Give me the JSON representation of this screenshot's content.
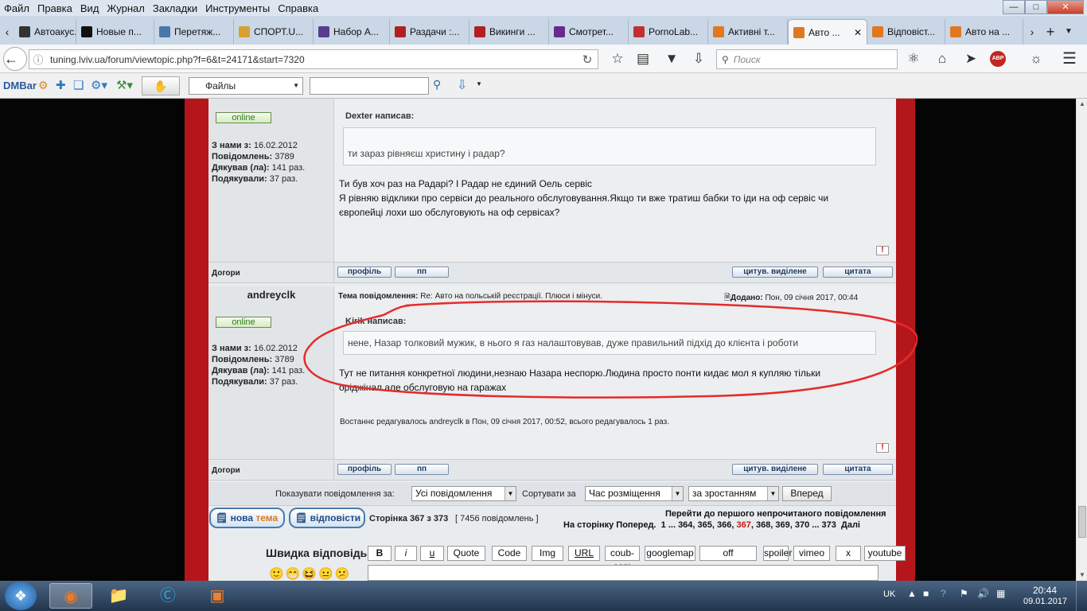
{
  "menu": [
    "Файл",
    "Правка",
    "Вид",
    "Журнал",
    "Закладки",
    "Инструменты",
    "Справка"
  ],
  "tabs": [
    {
      "label": "Автоакус...",
      "color": "#333"
    },
    {
      "label": "Новые п...",
      "color": "#111"
    },
    {
      "label": "Перетяж...",
      "color": "#4a76a8"
    },
    {
      "label": "СПОРТ.U...",
      "color": "#d8a030"
    },
    {
      "label": "Набор A...",
      "color": "#5a3c8c"
    },
    {
      "label": "Раздачи :...",
      "color": "#b02020"
    },
    {
      "label": "Викинги ...",
      "color": "#b02020"
    },
    {
      "label": "Смотрет...",
      "color": "#6a2a8a"
    },
    {
      "label": "PornoLab...",
      "color": "#c03030"
    },
    {
      "label": "Активні т...",
      "color": "#e07820"
    },
    {
      "label": "Авто ...",
      "color": "#e07820"
    },
    {
      "label": "Відповіст...",
      "color": "#e07820"
    },
    {
      "label": "Авто на ...",
      "color": "#e07820"
    }
  ],
  "url": "tuning.lviv.ua/forum/viewtopic.php?f=6&t=24171&start=7320",
  "search_placeholder": "Поиск",
  "dmbar": {
    "label": "DMBar",
    "files": "Файлы"
  },
  "post1": {
    "online": "online",
    "joined_label": "З нами з:",
    "joined": "16.02.2012",
    "posts_label": "Повідомлень:",
    "posts": "3789",
    "thanked_label": "Дякував (ла):",
    "thanked": "141 раз.",
    "thanks_label": "Подякували:",
    "thanks": "37 раз.",
    "quote_author": "Dexter написав:",
    "quote_text": "ти зараз рівняєш христину і радар?",
    "line1": "Ти був хоч раз на Радарі? І Радар не єдиний Оель сервіс",
    "line2": "Я рівняю відклики про сервіси до реального обслуговування.Якщо ти вже тратиш бабки то іди на оф сервіс чи",
    "line3": "європейці лохи шо обслуговують на оф сервісах?",
    "footer_left": "Догори"
  },
  "post2": {
    "author": "andreyclk",
    "topic_label": "Тема повідомлення:",
    "topic": "Re: Авто на польській реєстрації. Плюси і мінуси.",
    "added_label": "Додано:",
    "added": "Пон, 09 січня 2017, 00:44",
    "online": "online",
    "joined_label": "З нами з:",
    "joined": "16.02.2012",
    "posts_label": "Повідомлень:",
    "posts": "3789",
    "thanked_label": "Дякував (ла):",
    "thanked": "141 раз.",
    "thanks_label": "Подякували:",
    "thanks": "37 раз.",
    "quote_author": "Kirik написав:",
    "quote_text": "нене, Назар толковий мужик, в нього я газ налаштовував, дуже правильний підхід до клієнта і роботи",
    "line1": "Тут не питання конкретної людини,незнаю Назара неспорю.Людина просто понти кидає мол я купляю тільки",
    "line2": "оріджінал але обслуговую на гаражах",
    "edited": "Востаннє редагувалось andreyclk в Пон, 09 січня 2017, 00:52, всього редагувалось 1 раз.",
    "footer_left": "Догори"
  },
  "buttons": {
    "profile": "профіль",
    "pm": "пп",
    "quote_sel": "цитув. виділене",
    "quote": "цитата"
  },
  "sort": {
    "show_label": "Показувати повідомлення за:",
    "show_value": "Усі повідомлення",
    "sort_label": "Сортувати за",
    "sort_value": "Час розміщення",
    "order_value": "за зростанням",
    "go": "Вперед"
  },
  "pagination": {
    "new_topic_a": "нова",
    "new_topic_b": "тема",
    "reply": "відповісти",
    "page": "Сторінка 367 з 373",
    "count": "[ 7456 повідомлень ]",
    "first_unread": "Перейти до першого непрочитаного повідомлення",
    "goto_prefix": "На сторінку Поперед.  1 ... 364, 365, 366,",
    "current": "367",
    "goto_suffix": ", 368, 369, 370 ... 373  Далі"
  },
  "quick": {
    "title": "Швидка відповідь",
    "buttons": [
      "B",
      "i",
      "u",
      "Quote",
      "Code",
      "Img",
      "URL",
      "coub-com",
      "googlemap",
      "off",
      "spoiler",
      "vimeo",
      "x",
      "youtube"
    ]
  },
  "taskbar": {
    "lang": "UK",
    "time": "20:44",
    "date": "09.01.2017"
  }
}
